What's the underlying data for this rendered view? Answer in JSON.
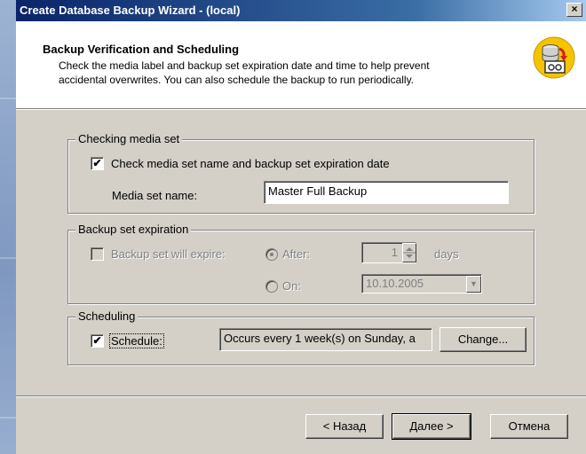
{
  "window": {
    "title": "Create Database Backup Wizard - (local)",
    "close_glyph": "×"
  },
  "header": {
    "title": "Backup Verification and Scheduling",
    "description": "Check the media label and backup set expiration date and time to help prevent accidental overwrites. You can also schedule the backup to run periodically.",
    "icon": "database-backup-icon"
  },
  "checking_media": {
    "legend": "Checking media set",
    "check_label": "Check media set name and backup set expiration date",
    "checked": true,
    "media_name_label": "Media set name:",
    "media_name_value": "Master Full Backup"
  },
  "expiration": {
    "legend": "Backup set expiration",
    "expire_label": "Backup set will expire:",
    "checked": false,
    "after_label": "After:",
    "after_value": "1",
    "days_label": "days",
    "on_label": "On:",
    "on_value": "10.10.2005"
  },
  "scheduling": {
    "legend": "Scheduling",
    "schedule_label": "Schedule:",
    "checked": true,
    "schedule_value": "Occurs every 1 week(s) on Sunday, a",
    "change_label": "Change..."
  },
  "buttons": {
    "back": "< Назад",
    "next": "Далее >",
    "cancel": "Отмена"
  },
  "check_glyph": "✔"
}
